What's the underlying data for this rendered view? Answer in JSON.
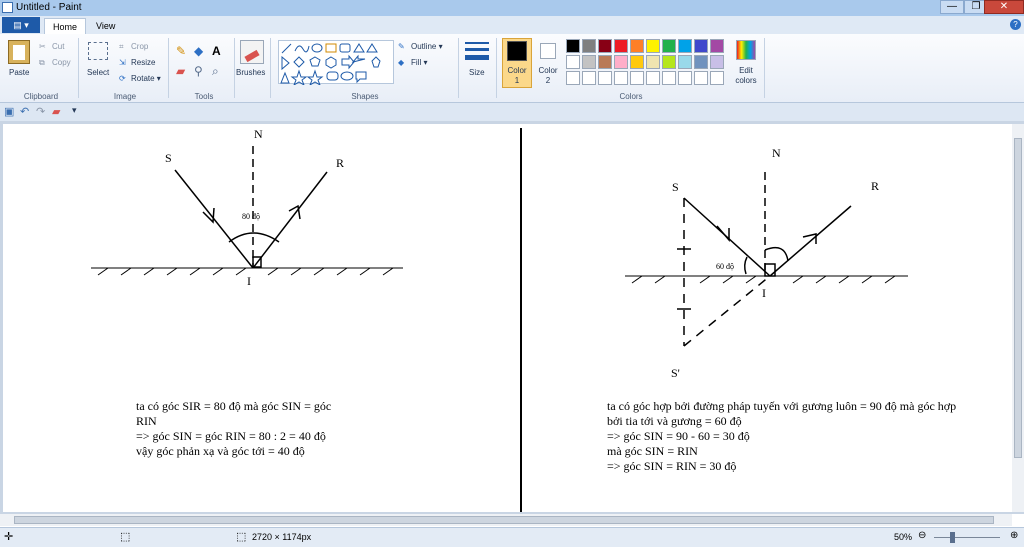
{
  "window": {
    "title": "Untitled - Paint",
    "controls": [
      "—",
      "❐",
      "✕"
    ]
  },
  "tabs": {
    "file": "▤ ▾",
    "home": "Home",
    "view": "View",
    "help": "?"
  },
  "clipboard": {
    "paste": "Paste",
    "cut": "Cut",
    "copy": "Copy",
    "group": "Clipboard"
  },
  "image": {
    "select": "Select",
    "crop": "Crop",
    "resize": "Resize",
    "rotate": "Rotate ▾",
    "group": "Image"
  },
  "tools": {
    "group": "Tools"
  },
  "brushes": {
    "label": "Brushes"
  },
  "shapes": {
    "outline": "Outline ▾",
    "fill": "Fill ▾",
    "group": "Shapes"
  },
  "size": {
    "label": "Size"
  },
  "colors": {
    "color1": "Color 1",
    "color2": "Color 2",
    "edit": "Edit colors",
    "group": "Colors",
    "color1_value": "#000000",
    "color2_value": "#ffffff",
    "palette_row1": [
      "#000000",
      "#7f7f7f",
      "#880015",
      "#ed1c24",
      "#ff7f27",
      "#fff200",
      "#22b14c",
      "#00a2e8",
      "#3f48cc",
      "#a349a4"
    ],
    "palette_row2": [
      "#ffffff",
      "#c3c3c3",
      "#b97a57",
      "#ffaec9",
      "#ffc90e",
      "#efe4b0",
      "#b5e61d",
      "#99d9ea",
      "#7092be",
      "#c8bfe7"
    ]
  },
  "drawing": {
    "left": {
      "N": "N",
      "S": "S",
      "R": "R",
      "I": "I",
      "angle": "80 độ",
      "text": [
        "ta có góc SIR = 80 độ mà góc SIN = góc",
        "RIN",
        "=> góc SIN = góc RIN = 80 :  2 = 40 độ",
        "vậy góc phản xạ và góc tới = 40 độ"
      ]
    },
    "right": {
      "N": "N",
      "S": "S",
      "R": "R",
      "I": "I",
      "S_prime": "S'",
      "angle": "60 độ",
      "text": [
        "ta có góc hợp bởi đường pháp tuyến với gương luôn = 90 độ mà góc hợp",
        "bởi tia tới và gương = 60 độ",
        "=> góc SIN = 90 - 60 = 30 độ",
        "mà góc SIN = RIN",
        "=> góc SIN = RIN =  30 độ"
      ]
    }
  },
  "status": {
    "dimensions": "2720 × 1174px",
    "zoom": "50%"
  }
}
